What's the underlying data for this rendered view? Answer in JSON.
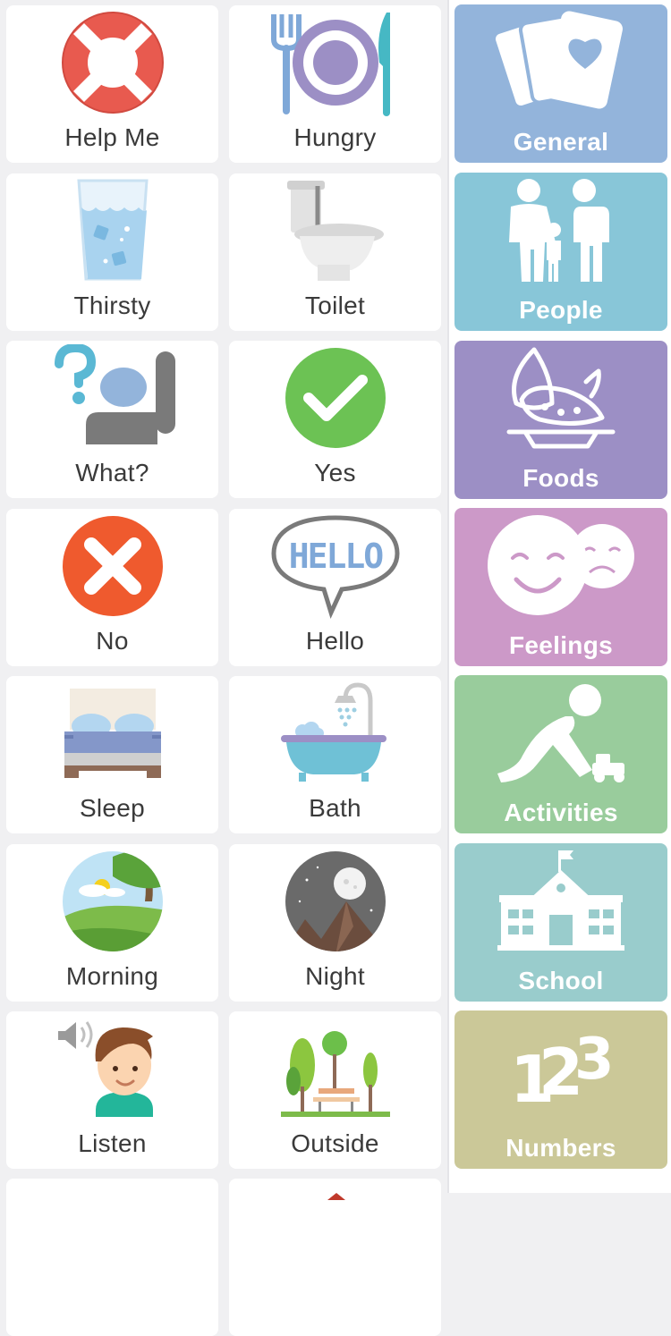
{
  "phrases": [
    {
      "label": "Help Me",
      "icon": "lifebuoy-icon"
    },
    {
      "label": "Hungry",
      "icon": "plate-cutlery-icon"
    },
    {
      "label": "Thirsty",
      "icon": "water-glass-icon"
    },
    {
      "label": "Toilet",
      "icon": "toilet-icon"
    },
    {
      "label": "What?",
      "icon": "question-person-icon"
    },
    {
      "label": "Yes",
      "icon": "checkmark-icon"
    },
    {
      "label": "No",
      "icon": "cross-icon"
    },
    {
      "label": "Hello",
      "icon": "hello-speech-bubble-icon"
    },
    {
      "label": "Sleep",
      "icon": "bed-icon"
    },
    {
      "label": "Bath",
      "icon": "bathtub-icon"
    },
    {
      "label": "Morning",
      "icon": "morning-landscape-icon"
    },
    {
      "label": "Night",
      "icon": "night-moon-icon"
    },
    {
      "label": "Listen",
      "icon": "boy-speaker-icon"
    },
    {
      "label": "Outside",
      "icon": "park-trees-icon"
    }
  ],
  "categories": [
    {
      "label": "General",
      "icon": "cards-heart-icon",
      "color": "#93b4db"
    },
    {
      "label": "People",
      "icon": "family-icon",
      "color": "#88c6d8"
    },
    {
      "label": "Foods",
      "icon": "food-plate-icon",
      "color": "#9c8fc5"
    },
    {
      "label": "Feelings",
      "icon": "happy-sad-faces-icon",
      "color": "#cc99c8"
    },
    {
      "label": "Activities",
      "icon": "child-playing-icon",
      "color": "#99cc9c"
    },
    {
      "label": "School",
      "icon": "school-building-icon",
      "color": "#99cccc"
    },
    {
      "label": "Numbers",
      "icon": "numbers-123-icon",
      "color": "#cbc898"
    }
  ]
}
